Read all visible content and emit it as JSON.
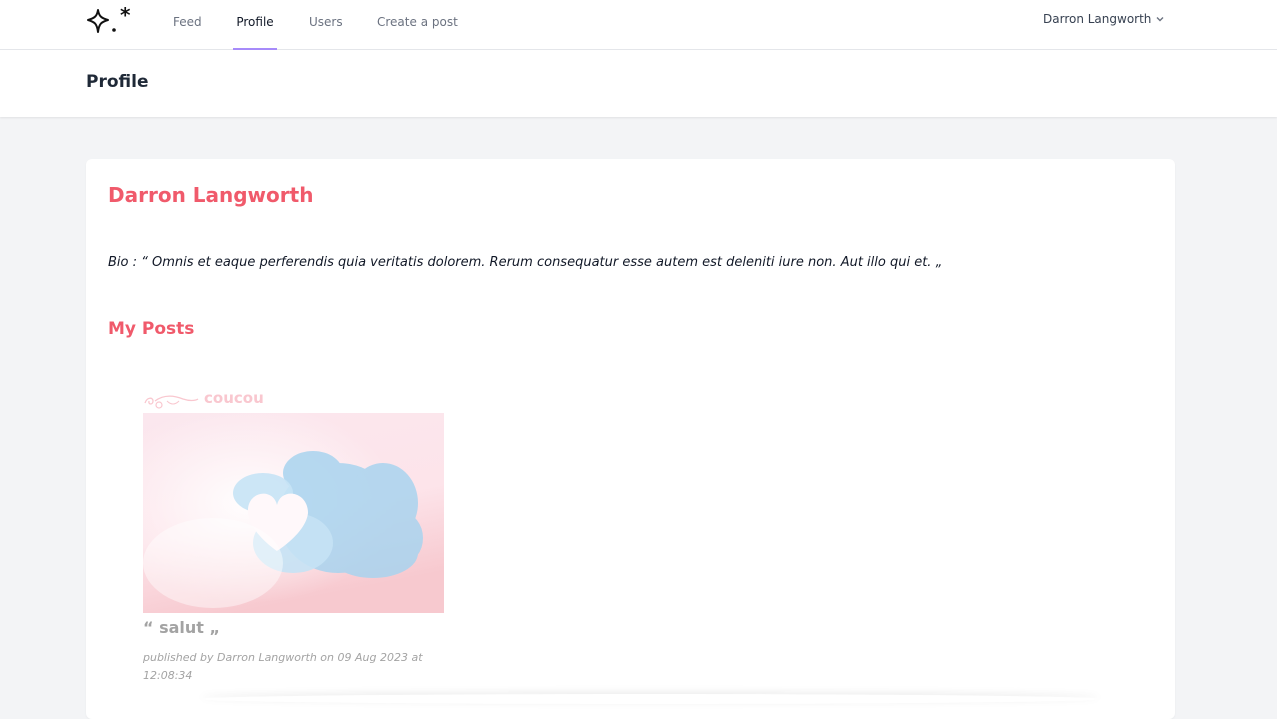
{
  "nav": {
    "links": [
      {
        "label": "Feed"
      },
      {
        "label": "Profile"
      },
      {
        "label": "Users"
      },
      {
        "label": "Create a post"
      }
    ],
    "active_tab": "Profile",
    "user_name": "Darron Langworth",
    "accent_color": "#a78bfa"
  },
  "page": {
    "title": "Profile"
  },
  "profile": {
    "name": "Darron Langworth",
    "bio": "Bio : “ Omnis et eaque perferendis quia veritatis dolorem. Rerum consequatur esse autem est deleniti iure non. Aut illo qui et. „",
    "name_color": "#f05a6b"
  },
  "posts_section": {
    "title": "My Posts",
    "posts": [
      {
        "title": "coucou",
        "quote": "“ salut „",
        "meta": "published by Darron Langworth on 09 Aug 2023 at 12:08:34",
        "image_icon": "heart-cloud-sky-image"
      }
    ]
  }
}
